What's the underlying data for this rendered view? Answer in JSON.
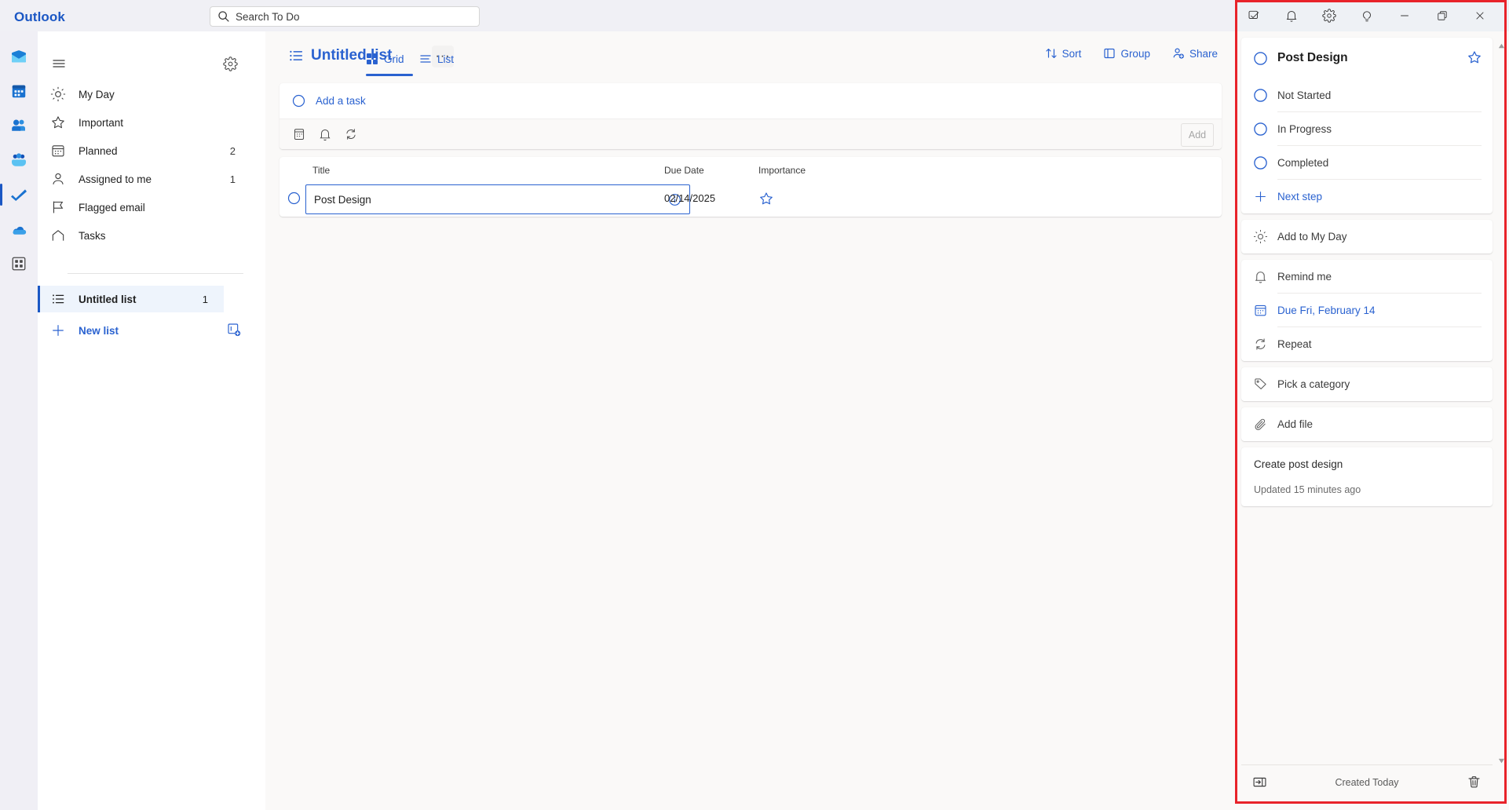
{
  "topbar": {
    "brand": "Outlook",
    "search": {
      "placeholder": "Search To Do",
      "value": "",
      "icon": "search-icon"
    }
  },
  "rail": {
    "items": [
      {
        "name": "mail-icon",
        "label": "Mail",
        "selected": false
      },
      {
        "name": "calendar-icon",
        "label": "Calendar",
        "selected": false
      },
      {
        "name": "people-icon",
        "label": "People",
        "selected": false
      },
      {
        "name": "teams-icon",
        "label": "Teams",
        "selected": false
      },
      {
        "name": "todo-icon",
        "label": "To Do",
        "selected": true
      },
      {
        "name": "onedrive-icon",
        "label": "OneDrive",
        "selected": false
      },
      {
        "name": "apps-icon",
        "label": "Apps",
        "selected": false
      }
    ]
  },
  "nav": {
    "menu_icon": "hamburger-icon",
    "settings_icon": "gear-icon",
    "items": [
      {
        "label": "My Day",
        "icon": "sun-icon",
        "count": ""
      },
      {
        "label": "Important",
        "icon": "star-icon",
        "count": ""
      },
      {
        "label": "Planned",
        "icon": "calendar-icon",
        "count": "2"
      },
      {
        "label": "Assigned to me",
        "icon": "person-icon",
        "count": "1"
      },
      {
        "label": "Flagged email",
        "icon": "flag-icon",
        "count": ""
      },
      {
        "label": "Tasks",
        "icon": "home-icon",
        "count": ""
      }
    ],
    "selected_list": {
      "label": "Untitled list",
      "icon": "list-icon",
      "count": "1"
    },
    "new_list": {
      "label": "New list",
      "icon": "plus-icon",
      "right_icon": "new-group-icon"
    }
  },
  "main": {
    "list_title": "Untitled list",
    "list_title_icon": "list-icon",
    "more_options": "···",
    "tabs": [
      {
        "label": "Grid",
        "icon": "grid-icon",
        "active": true
      },
      {
        "label": "List",
        "icon": "list-view-icon",
        "active": false
      }
    ],
    "actions": [
      {
        "label": "Sort",
        "icon": "sort-icon"
      },
      {
        "label": "Group",
        "icon": "group-icon"
      },
      {
        "label": "Share",
        "icon": "share-icon"
      }
    ],
    "add_task": {
      "label": "Add a task",
      "circle_icon": "circle-icon",
      "tools": [
        "calendar-icon",
        "bell-icon",
        "repeat-icon"
      ],
      "add_button": "Add"
    },
    "grid": {
      "columns": [
        "Title",
        "Due Date",
        "Importance"
      ],
      "rows": [
        {
          "title": "Post Design",
          "due_date": "02/14/2025",
          "importance_icon": "star-icon",
          "info_icon": "info-icon",
          "check_icon": "circle-icon"
        }
      ]
    }
  },
  "detail": {
    "window_buttons": [
      {
        "name": "tasks-icon",
        "label": "Tasks"
      },
      {
        "name": "bell-icon",
        "label": "Notifications"
      },
      {
        "name": "gear-icon",
        "label": "Settings"
      },
      {
        "name": "lightbulb-icon",
        "label": "Tips"
      },
      {
        "name": "minimize-icon",
        "label": "Minimize"
      },
      {
        "name": "restore-icon",
        "label": "Restore"
      },
      {
        "name": "close-icon",
        "label": "Close"
      }
    ],
    "task_title": "Post Design",
    "task_star_icon": "star-icon",
    "steps": [
      {
        "label": "Not Started",
        "close_icon": "close-icon"
      },
      {
        "label": "In Progress",
        "close_icon": "close-icon"
      },
      {
        "label": "Completed",
        "close_icon": "close-icon"
      }
    ],
    "next_step": {
      "label": "Next step",
      "icon": "plus-icon"
    },
    "options": [
      {
        "label": "Add to My Day",
        "icon": "sun-icon",
        "highlighted": false,
        "group": 1
      },
      {
        "label": "Remind me",
        "icon": "bell-icon",
        "highlighted": false,
        "group": 2
      },
      {
        "label": "Due Fri, February 14",
        "icon": "calendar-icon",
        "highlighted": true,
        "group": 2
      },
      {
        "label": "Repeat",
        "icon": "repeat-icon",
        "highlighted": false,
        "group": 2
      },
      {
        "label": "Pick a category",
        "icon": "tag-icon",
        "highlighted": false,
        "group": 3
      },
      {
        "label": "Add file",
        "icon": "paperclip-icon",
        "highlighted": false,
        "group": 4
      }
    ],
    "note": {
      "text": "Create post design",
      "updated": "Updated 15 minutes ago"
    },
    "footer": {
      "collapse_icon": "collapse-panel-icon",
      "created": "Created Today",
      "delete_icon": "trash-icon"
    }
  },
  "colors": {
    "accent": "#2a62d0",
    "brand": "#1b57c4",
    "highlight_box": "#e8232a",
    "topbar_bg": "#f0f0f5",
    "main_bg": "#faf9f8",
    "selected_nav_bg": "#eef4fc"
  }
}
